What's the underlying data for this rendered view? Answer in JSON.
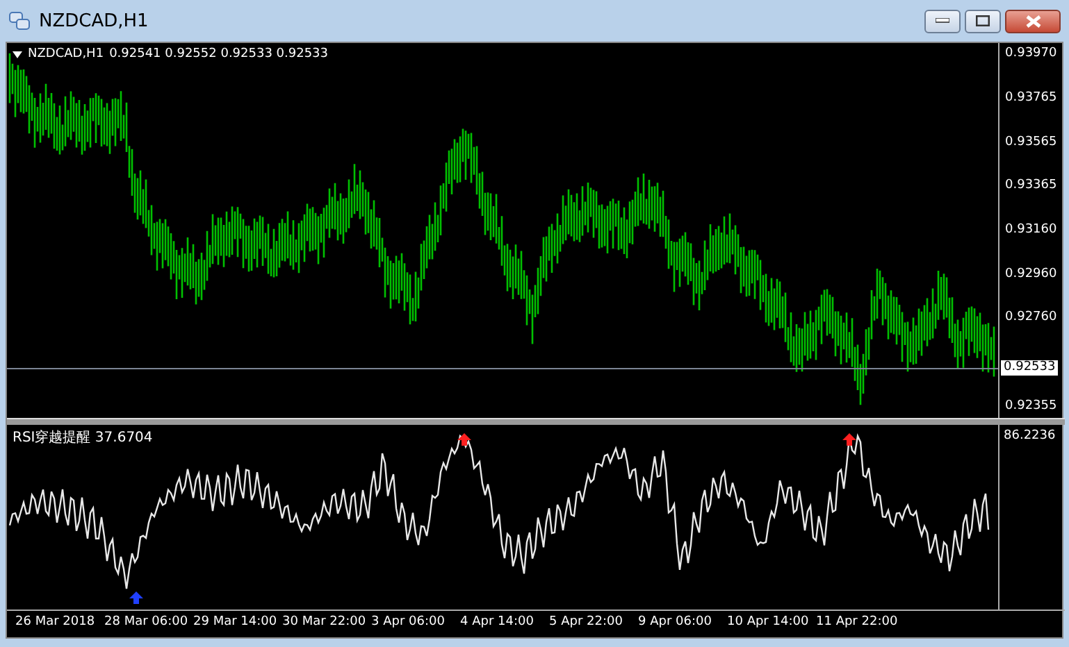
{
  "window": {
    "title": "NZDCAD,H1"
  },
  "chart": {
    "label": "NZDCAD,H1",
    "ohlc": "0.92541 0.92552 0.92533 0.92533",
    "price_ticks": [
      "0.93970",
      "0.93765",
      "0.93565",
      "0.93365",
      "0.93160",
      "0.92960",
      "0.92760",
      "0.92355"
    ],
    "current_price": "0.92533"
  },
  "indicator": {
    "label": "RSI穿越提醒 37.6704",
    "axis_value": "86.2236"
  },
  "time_axis": [
    "26 Mar 2018",
    "28 Mar 06:00",
    "29 Mar 14:00",
    "30 Mar 22:00",
    "3 Apr 06:00",
    "4 Apr 14:00",
    "5 Apr 22:00",
    "9 Apr 06:00",
    "10 Apr 14:00",
    "11 Apr 22:00"
  ]
}
